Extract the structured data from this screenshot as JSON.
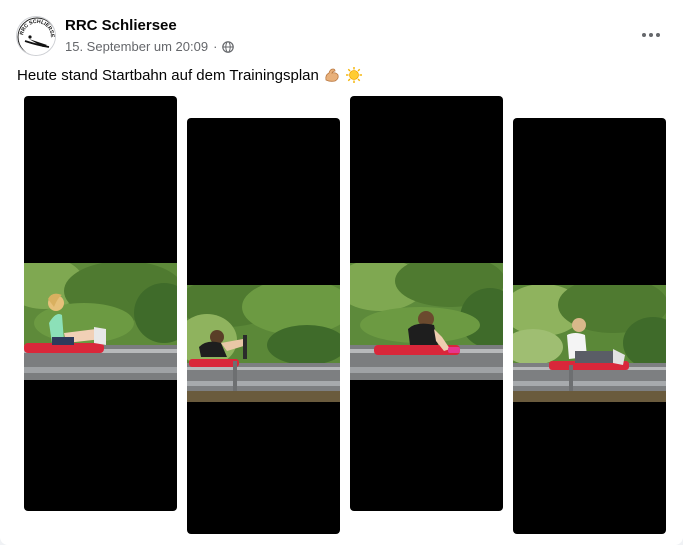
{
  "post": {
    "author": "RRC Schliersee",
    "timestamp": "15. September um 20:09",
    "separator": "·",
    "privacy_icon": "globe-icon",
    "menu_icon": "more-options-icon",
    "text": "Heute stand Startbahn auf dem Trainingsplan",
    "emojis": [
      "flexed-biceps-icon",
      "sun-icon"
    ]
  },
  "avatar": {
    "label": "RRC SCHLIERSEE"
  },
  "colors": {
    "foliage_dark": "#3f6b2a",
    "foliage_light": "#7fa851",
    "sled_red": "#d9273a",
    "track_grey": "#8a8d90",
    "meta_grey": "#65676b"
  },
  "media": {
    "frames": [
      {
        "id": "frame-1",
        "subject": "child-sliding-green-shirt"
      },
      {
        "id": "frame-2",
        "subject": "child-lying-on-sled"
      },
      {
        "id": "frame-3",
        "subject": "child-pushing-off-sled"
      },
      {
        "id": "frame-4",
        "subject": "child-sitting-on-sled"
      }
    ]
  }
}
